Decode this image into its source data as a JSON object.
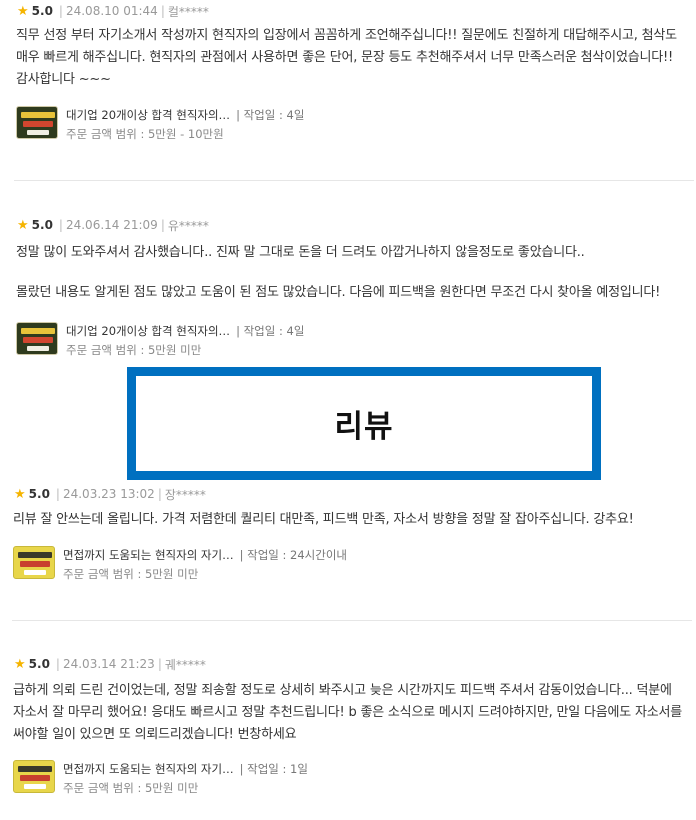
{
  "overlay_label": "리뷰",
  "reviews": [
    {
      "score": "5.0",
      "date": "24.08.10 01:44",
      "user": "컬*****",
      "paragraphs": [
        "직무 선정 부터 자기소개서 작성까지 현직자의 입장에서 꼼꼼하게 조언해주십니다!! 질문에도 친절하게 대답해주시고, 첨삭도 매우 빠르게 해주십니다. 현직자의 관점에서 사용하면 좋은 단어, 문장 등도 추천해주셔서 너무 만족스러운 첨삭이었습니다!! 감사합니다 ~~~"
      ],
      "product_title": "대기업 20개이상 합격 현직자의…",
      "work_days": "| 작업일 : 4일",
      "price_range": "주문 금액 범위 : 5만원 - 10만원"
    },
    {
      "score": "5.0",
      "date": "24.06.14 21:09",
      "user": "유*****",
      "paragraphs": [
        "정말 많이 도와주셔서 감사했습니다.. 진짜 말 그대로 돈을 더 드려도 아깝거나하지 않을정도로 좋았습니다..",
        "몰랐던 내용도 알게된 점도 많았고 도움이 된 점도 많았습니다. 다음에 피드백을 원한다면 무조건 다시 찾아올 예정입니다!"
      ],
      "product_title": "대기업 20개이상 합격 현직자의…",
      "work_days": "| 작업일 : 4일",
      "price_range": "주문 금액 범위 : 5만원 미만"
    },
    {
      "score": "5.0",
      "date": "24.03.23 13:02",
      "user": "장*****",
      "paragraphs": [
        "리뷰 잘 안쓰는데 올립니다. 가격 저렴한데 퀄리티 대만족, 피드백 만족, 자소서 방향을 정말 잘 잡아주십니다. 강추요!"
      ],
      "product_title": "면접까지 도움되는 현직자의 자기…",
      "work_days": "| 작업일 : 24시간이내",
      "price_range": "주문 금액 범위 : 5만원 미만"
    },
    {
      "score": "5.0",
      "date": "24.03.14 21:23",
      "user": "궤*****",
      "paragraphs": [
        "급하게 의뢰 드린 건이었는데, 정말 죄송할 정도로 상세히 봐주시고 늦은 시간까지도 피드백 주셔서 감동이었습니다... 덕분에 자소서 잘 마무리 했어요! 응대도 빠르시고 정말 추천드립니다! b 좋은 소식으로 메시지 드려야하지만, 만일 다음에도 자소서를 써야할 일이 있으면 또 의뢰드리겠습니다! 번창하세요"
      ],
      "product_title": "면접까지 도움되는 현직자의 자기…",
      "work_days": "| 작업일 : 1일",
      "price_range": "주문 금액 범위 : 5만원 미만"
    }
  ]
}
